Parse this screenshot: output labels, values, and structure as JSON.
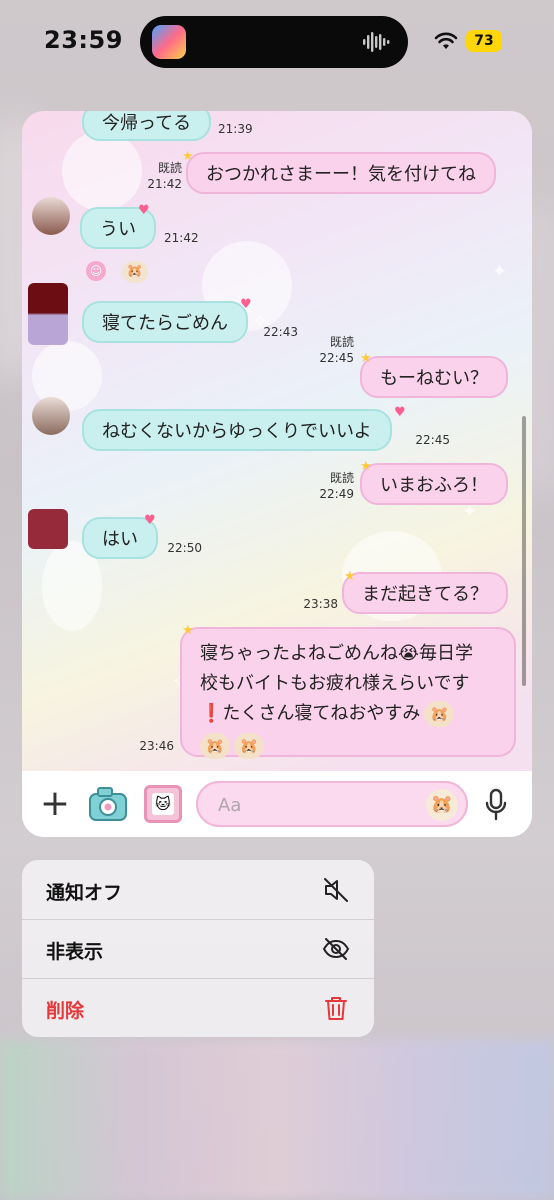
{
  "status_bar": {
    "time": "23:59",
    "battery": "73"
  },
  "chat": {
    "messages": [
      {
        "side": "in",
        "text": "今帰ってる",
        "time": "21:39"
      },
      {
        "side": "out",
        "text": "おつかれさまーー！気を付けてね",
        "read": "既読",
        "time": "21:42"
      },
      {
        "side": "in",
        "text": "うい",
        "time": "21:42"
      },
      {
        "side": "in",
        "text": "寝てたらごめん",
        "time": "22:43"
      },
      {
        "side": "out",
        "text": "もーねむい？",
        "read": "既読",
        "time": "22:45"
      },
      {
        "side": "in",
        "text": "ねむくないからゆっくりでいいよ",
        "time": "22:45"
      },
      {
        "side": "out",
        "text": "いまおふろ！",
        "read": "既読",
        "time": "22:49"
      },
      {
        "side": "in",
        "text": "はい",
        "time": "22:50"
      },
      {
        "side": "out",
        "text": "まだ起きてる？",
        "time": "23:38"
      },
      {
        "side": "out",
        "text_line1": "寝ちゃったよねごめんね😭毎日学",
        "text_line2": "校もバイトもお疲れ様えらいです",
        "text_line3": "❗たくさん寝てねおやすみ",
        "time": "23:46"
      }
    ]
  },
  "input_bar": {
    "placeholder": "Aa"
  },
  "menu": {
    "items": [
      {
        "label": "通知オフ",
        "icon": "speaker-mute-icon"
      },
      {
        "label": "非表示",
        "icon": "eye-slash-icon"
      },
      {
        "label": "削除",
        "icon": "trash-icon",
        "color": "#e5383b"
      }
    ]
  }
}
